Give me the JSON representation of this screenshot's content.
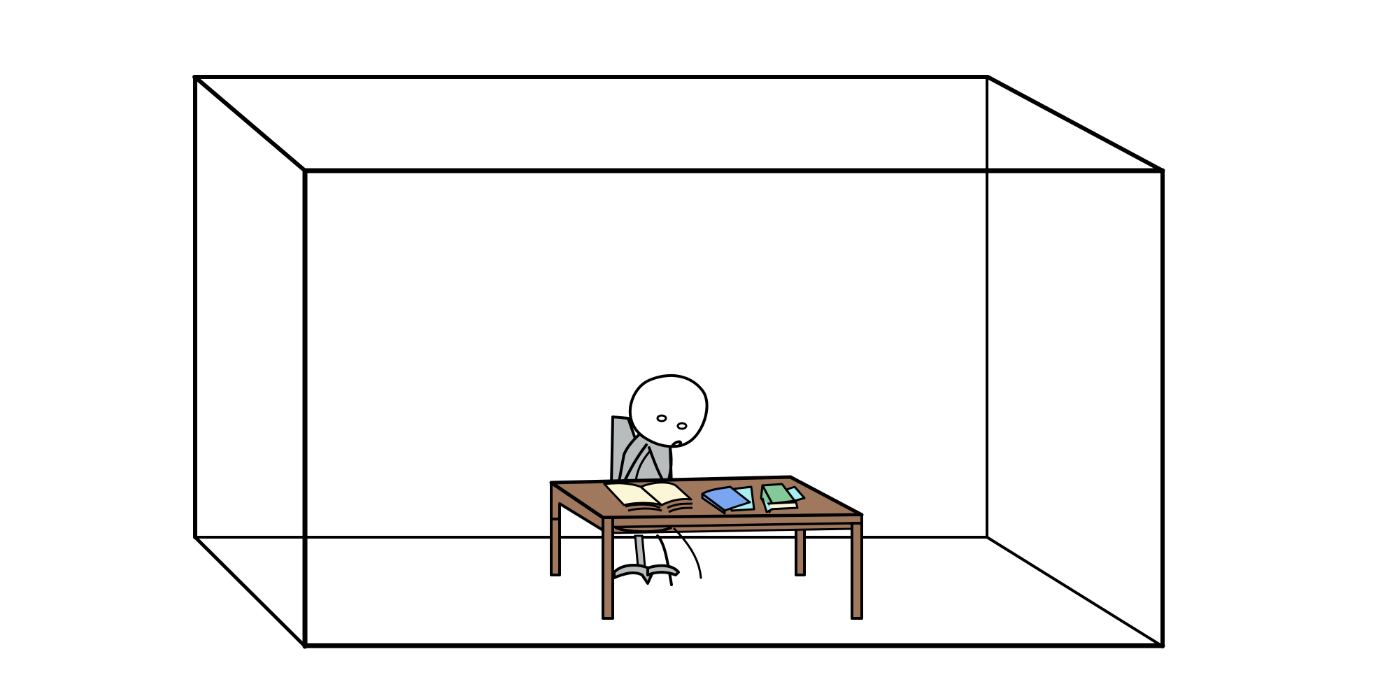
{
  "scene": {
    "description_icon": "student-at-desk-illustration",
    "objects": [
      "room-box",
      "desk",
      "chair",
      "person",
      "open-book",
      "blue-book",
      "green-book-stack"
    ]
  },
  "colors": {
    "background": "#ffffff",
    "line": "#000000",
    "desk": "#a0785e",
    "chair": "#b8bcbd",
    "book_pages": "#fbf7d6",
    "blue_book": "#7aa6f0",
    "cyan_book": "#a8eef2",
    "green_book": "#85c89a",
    "skin": "#ffffff"
  }
}
